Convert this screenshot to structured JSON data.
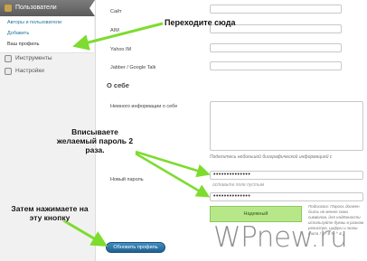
{
  "sidebar": {
    "users_menu": "Пользователи",
    "submenu": [
      "Авторы и пользователи",
      "Добавить",
      "Ваш профиль"
    ],
    "items": [
      {
        "label": "Инструменты",
        "icon": "wrench-icon"
      },
      {
        "label": "Настройки",
        "icon": "settings-icon"
      }
    ]
  },
  "form": {
    "site_label": "Сайт",
    "aim_label": "AIM",
    "yahoo_label": "Yahoo IM",
    "jabber_label": "Jabber / Google Talk",
    "about_title": "О себе",
    "bio_label": "Немного информации о себе",
    "bio_hint": "Поделитесь небольшой биографической информацией с",
    "new_password_label": "Новый пароль",
    "password_value": "••••••••••••••",
    "password_hint": "оставьте поле пустым",
    "password_confirm_value": "••••••••••••••",
    "strength_label": "Надежный",
    "strength_hint": "Подсказка: Пароль должен быть не менее семи символов, для надёжности используйте буквы в разном регистре, цифры и знаки типа ! \" ? $ % ^ & )",
    "update_button": "Обновить профиль"
  },
  "annotations": {
    "go_here": "Переходите сюда",
    "enter_password": "Вписываете желаемый пароль 2 раза.",
    "press_button": "Затем нажимаете на эту кнопку"
  },
  "watermark": "WPnew.ru",
  "colors": {
    "arrow": "#7ddc2e",
    "button": "#21628f",
    "strength_ok": "#b6e88a"
  }
}
